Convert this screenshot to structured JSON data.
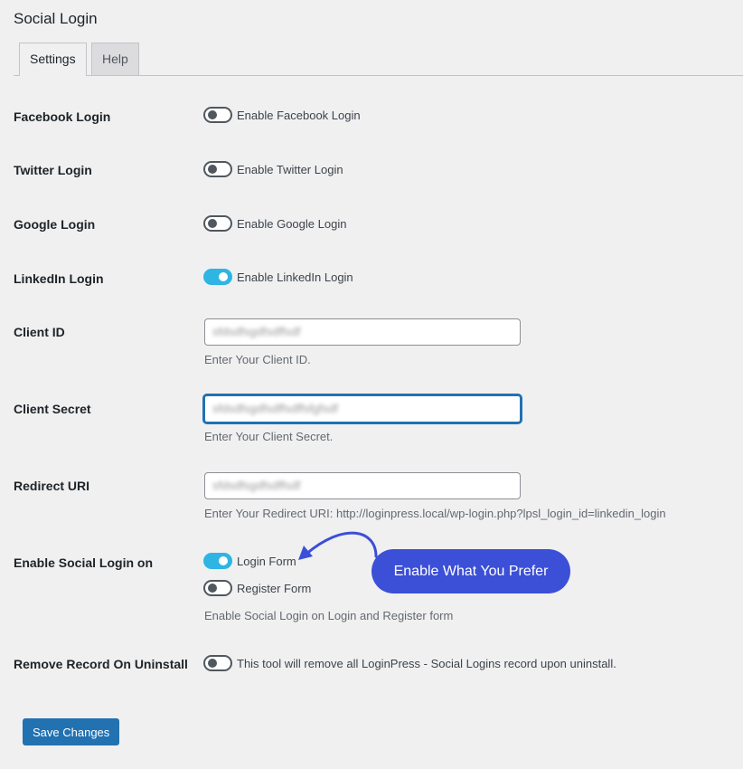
{
  "page": {
    "title": "Social Login"
  },
  "tabs": [
    {
      "label": "Settings",
      "active": true
    },
    {
      "label": "Help",
      "active": false
    }
  ],
  "rows": {
    "facebook": {
      "label": "Facebook Login",
      "toggle_text": "Enable Facebook Login",
      "enabled": false
    },
    "twitter": {
      "label": "Twitter Login",
      "toggle_text": "Enable Twitter Login",
      "enabled": false
    },
    "google": {
      "label": "Google Login",
      "toggle_text": "Enable Google Login",
      "enabled": false
    },
    "linkedin": {
      "label": "LinkedIn Login",
      "toggle_text": "Enable LinkedIn Login",
      "enabled": true
    }
  },
  "client_id": {
    "label": "Client ID",
    "value": "sfdsdfsgdfsdffsdf",
    "description": "Enter Your Client ID."
  },
  "client_secret": {
    "label": "Client Secret",
    "value": "sfdsdfsgdfsdffsdffsfgfsdf",
    "description": "Enter Your Client Secret."
  },
  "redirect_uri": {
    "label": "Redirect URI",
    "value": "sfdsdfsgdfsdffsdf",
    "description": "Enter Your Redirect URI: http://loginpress.local/wp-login.php?lpsl_login_id=linkedin_login"
  },
  "enable_on": {
    "label": "Enable Social Login on",
    "login_form": {
      "text": "Login Form",
      "enabled": true
    },
    "register_form": {
      "text": "Register Form",
      "enabled": false
    },
    "description": "Enable Social Login on Login and Register form"
  },
  "remove_record": {
    "label": "Remove Record On Uninstall",
    "toggle_text": "This tool will remove all LoginPress - Social Logins record upon uninstall.",
    "enabled": false
  },
  "callout": {
    "text": "Enable What You Prefer"
  },
  "save_label": "Save Changes",
  "colors": {
    "accent": "#2271b1",
    "toggle_on": "#2eb5e3",
    "callout": "#3c4fd7"
  }
}
